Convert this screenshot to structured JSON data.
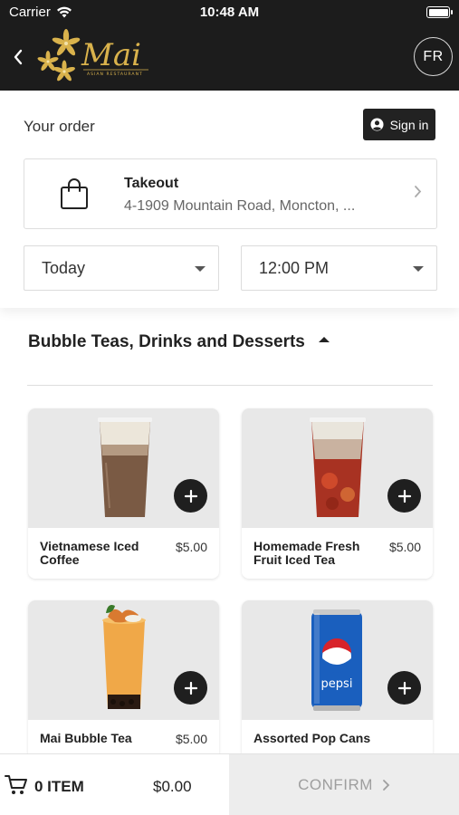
{
  "status_bar": {
    "carrier": "Carrier",
    "time": "10:48 AM",
    "icons": [
      "wifi-icon",
      "battery-icon"
    ]
  },
  "header": {
    "logo_text": "Mai",
    "logo_subtitle": "ASIAN RESTAURANT",
    "language_button": "FR",
    "brand_color": "#1c1c1c",
    "accent_color": "#d9b24c"
  },
  "order": {
    "heading": "Your order",
    "sign_in_label": "Sign in",
    "mode_title": "Takeout",
    "address": "4-1909 Mountain Road, Moncton, ...",
    "day_value": "Today",
    "time_value": "12:00 PM"
  },
  "category": {
    "title": "Bubble Teas, Drinks and Desserts",
    "expanded": true
  },
  "products": [
    {
      "name": "Vietnamese Iced Coffee",
      "price": "$5.00"
    },
    {
      "name": "Homemade Fresh Fruit Iced Tea",
      "price": "$5.00"
    },
    {
      "name": "Mai Bubble Tea",
      "price": "$5.00"
    },
    {
      "name": "Assorted Pop Cans",
      "price": ""
    }
  ],
  "cart": {
    "count_label": "0 ITEM",
    "total": "$0.00",
    "confirm_label": "CONFIRM"
  }
}
